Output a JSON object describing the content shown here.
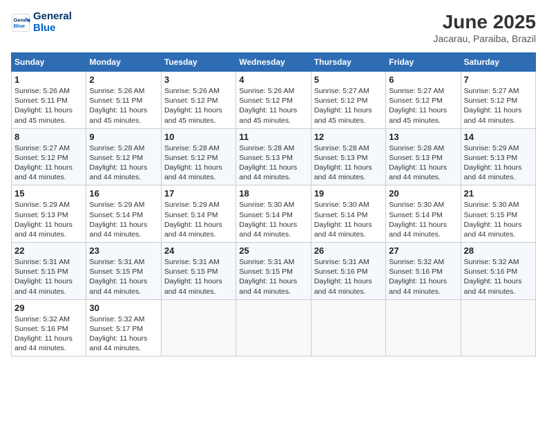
{
  "header": {
    "logo_line1": "General",
    "logo_line2": "Blue",
    "month_year": "June 2025",
    "location": "Jacarau, Paraiba, Brazil"
  },
  "weekdays": [
    "Sunday",
    "Monday",
    "Tuesday",
    "Wednesday",
    "Thursday",
    "Friday",
    "Saturday"
  ],
  "weeks": [
    [
      {
        "day": "1",
        "info": "Sunrise: 5:26 AM\nSunset: 5:11 PM\nDaylight: 11 hours\nand 45 minutes."
      },
      {
        "day": "2",
        "info": "Sunrise: 5:26 AM\nSunset: 5:11 PM\nDaylight: 11 hours\nand 45 minutes."
      },
      {
        "day": "3",
        "info": "Sunrise: 5:26 AM\nSunset: 5:12 PM\nDaylight: 11 hours\nand 45 minutes."
      },
      {
        "day": "4",
        "info": "Sunrise: 5:26 AM\nSunset: 5:12 PM\nDaylight: 11 hours\nand 45 minutes."
      },
      {
        "day": "5",
        "info": "Sunrise: 5:27 AM\nSunset: 5:12 PM\nDaylight: 11 hours\nand 45 minutes."
      },
      {
        "day": "6",
        "info": "Sunrise: 5:27 AM\nSunset: 5:12 PM\nDaylight: 11 hours\nand 45 minutes."
      },
      {
        "day": "7",
        "info": "Sunrise: 5:27 AM\nSunset: 5:12 PM\nDaylight: 11 hours\nand 44 minutes."
      }
    ],
    [
      {
        "day": "8",
        "info": "Sunrise: 5:27 AM\nSunset: 5:12 PM\nDaylight: 11 hours\nand 44 minutes."
      },
      {
        "day": "9",
        "info": "Sunrise: 5:28 AM\nSunset: 5:12 PM\nDaylight: 11 hours\nand 44 minutes."
      },
      {
        "day": "10",
        "info": "Sunrise: 5:28 AM\nSunset: 5:12 PM\nDaylight: 11 hours\nand 44 minutes."
      },
      {
        "day": "11",
        "info": "Sunrise: 5:28 AM\nSunset: 5:13 PM\nDaylight: 11 hours\nand 44 minutes."
      },
      {
        "day": "12",
        "info": "Sunrise: 5:28 AM\nSunset: 5:13 PM\nDaylight: 11 hours\nand 44 minutes."
      },
      {
        "day": "13",
        "info": "Sunrise: 5:28 AM\nSunset: 5:13 PM\nDaylight: 11 hours\nand 44 minutes."
      },
      {
        "day": "14",
        "info": "Sunrise: 5:29 AM\nSunset: 5:13 PM\nDaylight: 11 hours\nand 44 minutes."
      }
    ],
    [
      {
        "day": "15",
        "info": "Sunrise: 5:29 AM\nSunset: 5:13 PM\nDaylight: 11 hours\nand 44 minutes."
      },
      {
        "day": "16",
        "info": "Sunrise: 5:29 AM\nSunset: 5:14 PM\nDaylight: 11 hours\nand 44 minutes."
      },
      {
        "day": "17",
        "info": "Sunrise: 5:29 AM\nSunset: 5:14 PM\nDaylight: 11 hours\nand 44 minutes."
      },
      {
        "day": "18",
        "info": "Sunrise: 5:30 AM\nSunset: 5:14 PM\nDaylight: 11 hours\nand 44 minutes."
      },
      {
        "day": "19",
        "info": "Sunrise: 5:30 AM\nSunset: 5:14 PM\nDaylight: 11 hours\nand 44 minutes."
      },
      {
        "day": "20",
        "info": "Sunrise: 5:30 AM\nSunset: 5:14 PM\nDaylight: 11 hours\nand 44 minutes."
      },
      {
        "day": "21",
        "info": "Sunrise: 5:30 AM\nSunset: 5:15 PM\nDaylight: 11 hours\nand 44 minutes."
      }
    ],
    [
      {
        "day": "22",
        "info": "Sunrise: 5:31 AM\nSunset: 5:15 PM\nDaylight: 11 hours\nand 44 minutes."
      },
      {
        "day": "23",
        "info": "Sunrise: 5:31 AM\nSunset: 5:15 PM\nDaylight: 11 hours\nand 44 minutes."
      },
      {
        "day": "24",
        "info": "Sunrise: 5:31 AM\nSunset: 5:15 PM\nDaylight: 11 hours\nand 44 minutes."
      },
      {
        "day": "25",
        "info": "Sunrise: 5:31 AM\nSunset: 5:15 PM\nDaylight: 11 hours\nand 44 minutes."
      },
      {
        "day": "26",
        "info": "Sunrise: 5:31 AM\nSunset: 5:16 PM\nDaylight: 11 hours\nand 44 minutes."
      },
      {
        "day": "27",
        "info": "Sunrise: 5:32 AM\nSunset: 5:16 PM\nDaylight: 11 hours\nand 44 minutes."
      },
      {
        "day": "28",
        "info": "Sunrise: 5:32 AM\nSunset: 5:16 PM\nDaylight: 11 hours\nand 44 minutes."
      }
    ],
    [
      {
        "day": "29",
        "info": "Sunrise: 5:32 AM\nSunset: 5:16 PM\nDaylight: 11 hours\nand 44 minutes."
      },
      {
        "day": "30",
        "info": "Sunrise: 5:32 AM\nSunset: 5:17 PM\nDaylight: 11 hours\nand 44 minutes."
      },
      {
        "day": "",
        "info": ""
      },
      {
        "day": "",
        "info": ""
      },
      {
        "day": "",
        "info": ""
      },
      {
        "day": "",
        "info": ""
      },
      {
        "day": "",
        "info": ""
      }
    ]
  ]
}
